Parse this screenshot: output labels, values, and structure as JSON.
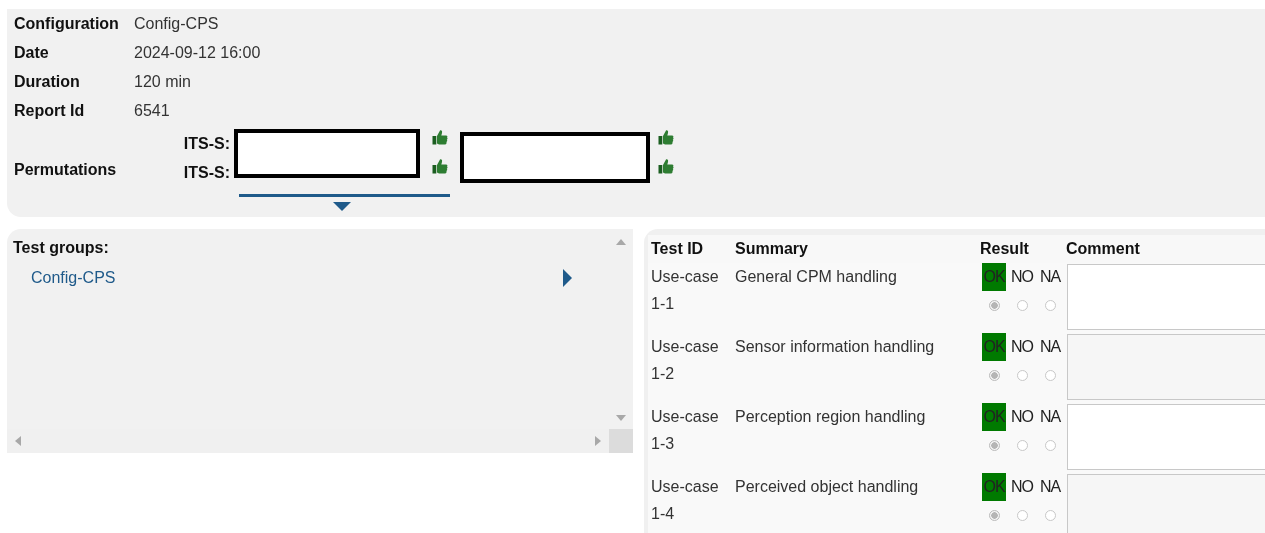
{
  "report": {
    "fields": [
      {
        "label": "Configuration",
        "value": "Config-CPS"
      },
      {
        "label": "Date",
        "value": "2024-09-12 16:00"
      },
      {
        "label": "Duration",
        "value": "120 min"
      },
      {
        "label": "Report Id",
        "value": "6541"
      }
    ],
    "permutations": {
      "label": "Permutations",
      "rows": [
        {
          "label": "ITS-S:"
        },
        {
          "label": "ITS-S:"
        }
      ]
    }
  },
  "test_groups": {
    "title": "Test groups:",
    "items": [
      {
        "label": "Config-CPS"
      }
    ]
  },
  "tests": {
    "columns": [
      "Test ID",
      "Summary",
      "Result",
      "Comment"
    ],
    "rows": [
      {
        "test_id": "Use-case 1-1",
        "summary": "General CPM handling",
        "results": [
          {
            "label": "OK",
            "selected": true
          },
          {
            "label": "NO",
            "selected": false
          },
          {
            "label": "NA",
            "selected": false
          }
        ]
      },
      {
        "test_id": "Use-case 1-2",
        "summary": "Sensor information handling",
        "results": [
          {
            "label": "OK",
            "selected": true
          },
          {
            "label": "NO",
            "selected": false
          },
          {
            "label": "NA",
            "selected": false
          }
        ]
      },
      {
        "test_id": "Use-case 1-3",
        "summary": "Perception region handling",
        "results": [
          {
            "label": "OK",
            "selected": true
          },
          {
            "label": "NO",
            "selected": false
          },
          {
            "label": "NA",
            "selected": false
          }
        ]
      },
      {
        "test_id": "Use-case 1-4",
        "summary": "Perceived object handling",
        "results": [
          {
            "label": "OK",
            "selected": true
          },
          {
            "label": "NO",
            "selected": false
          },
          {
            "label": "NA",
            "selected": false
          }
        ]
      }
    ]
  }
}
